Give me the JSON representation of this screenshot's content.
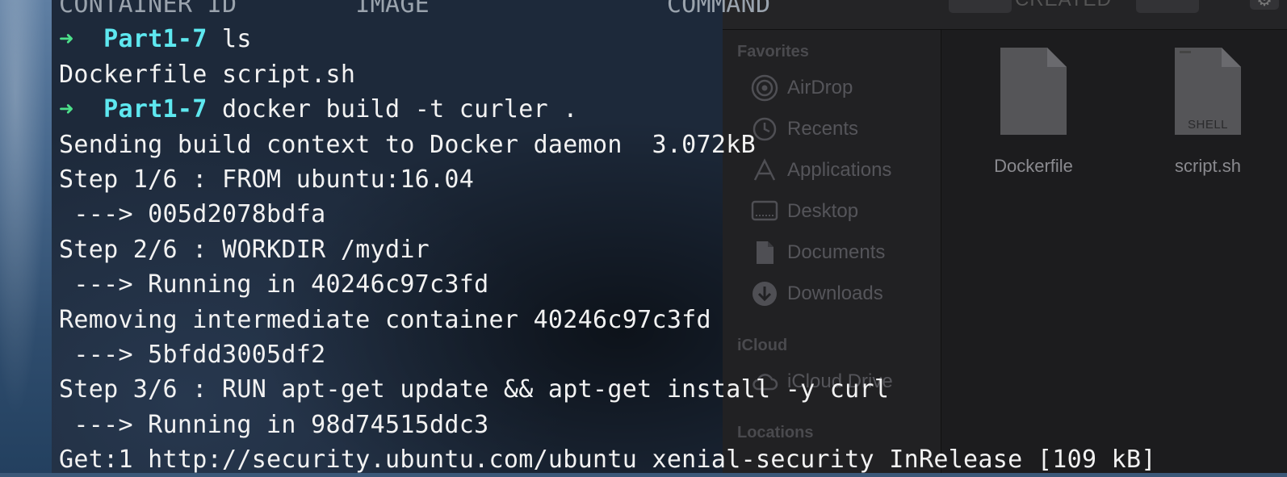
{
  "finder": {
    "toolbar": {
      "column_header": "CREATED"
    },
    "sidebar": {
      "favorites_label": "Favorites",
      "items": [
        {
          "label": "AirDrop",
          "icon": "airdrop-icon"
        },
        {
          "label": "Recents",
          "icon": "clock-icon"
        },
        {
          "label": "Applications",
          "icon": "applications-icon"
        },
        {
          "label": "Desktop",
          "icon": "desktop-icon"
        },
        {
          "label": "Documents",
          "icon": "documents-icon"
        },
        {
          "label": "Downloads",
          "icon": "downloads-icon"
        }
      ],
      "icloud_label": "iCloud",
      "icloud_items": [
        {
          "label": "iCloud Drive",
          "icon": "cloud-icon"
        }
      ],
      "locations_label": "Locations"
    },
    "files": [
      {
        "name": "Dockerfile",
        "icon": "document-icon",
        "badge": ""
      },
      {
        "name": "script.sh",
        "icon": "shell-script-icon",
        "badge": "SHELL"
      }
    ]
  },
  "terminal": {
    "header_fragment": "CONTAINER ID        IMAGE                COMMAND",
    "prompt_symbol": "➜",
    "prompt_dir": "Part1-7",
    "lines": [
      {
        "type": "prompt",
        "cmd": "ls"
      },
      {
        "type": "out",
        "text": "Dockerfile script.sh"
      },
      {
        "type": "prompt",
        "cmd": "docker build -t curler ."
      },
      {
        "type": "out",
        "text": "Sending build context to Docker daemon  3.072kB"
      },
      {
        "type": "out",
        "text": "Step 1/6 : FROM ubuntu:16.04"
      },
      {
        "type": "out",
        "text": " ---> 005d2078bdfa"
      },
      {
        "type": "out",
        "text": "Step 2/6 : WORKDIR /mydir"
      },
      {
        "type": "out",
        "text": " ---> Running in 40246c97c3fd"
      },
      {
        "type": "out",
        "text": "Removing intermediate container 40246c97c3fd"
      },
      {
        "type": "out",
        "text": " ---> 5bfdd3005df2"
      },
      {
        "type": "out",
        "text": "Step 3/6 : RUN apt-get update && apt-get install -y curl"
      },
      {
        "type": "out",
        "text": " ---> Running in 98d74515ddc3"
      },
      {
        "type": "out",
        "text": "Get:1 http://security.ubuntu.com/ubuntu xenial-security InRelease [109 kB]"
      }
    ]
  },
  "colors": {
    "prompt_arrow": "#4de08a",
    "prompt_dir": "#5ee8f0",
    "terminal_text": "#f2f2f2",
    "finder_bg": "#1c1c1e"
  }
}
